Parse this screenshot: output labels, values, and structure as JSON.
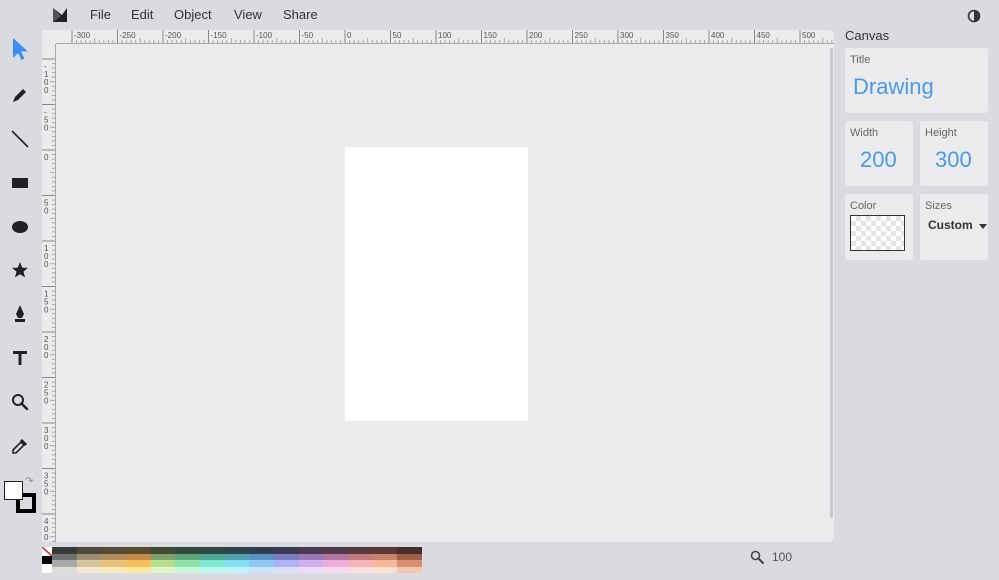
{
  "menubar": {
    "logo_icon": "method-draw-logo",
    "items": [
      "File",
      "Edit",
      "Object",
      "View",
      "Share"
    ],
    "theme_icon": "contrast-icon"
  },
  "toolbar": {
    "tools": [
      "select-tool",
      "pencil-tool",
      "line-tool",
      "rectangle-tool",
      "ellipse-tool",
      "star-tool",
      "pen-tool",
      "text-tool",
      "zoom-tool",
      "eyedropper-tool"
    ],
    "active": "select-tool",
    "fill_color": "#ffffff",
    "stroke_color": "#000000"
  },
  "rulers": {
    "x_ticks": [
      "-300",
      "-250",
      "-200",
      "-150",
      "-100",
      "-50",
      "0",
      "50",
      "100",
      "150",
      "200",
      "250",
      "300",
      "350",
      "400",
      "450",
      "500"
    ],
    "y_ticks": [
      "-100",
      "-50",
      "0",
      "50",
      "100",
      "150",
      "200",
      "250",
      "300",
      "350",
      "400"
    ]
  },
  "palette": {
    "rows": [
      [
        "#3a3a3a",
        "#504a3e",
        "#574b36",
        "#5c4a2e",
        "#3f4a33",
        "#324a3a",
        "#2d4a45",
        "#2d454d",
        "#2e3f52",
        "#3a3a54",
        "#4a3a52",
        "#523a4a",
        "#573a3e",
        "#5a3a34",
        "#4a2e2e"
      ],
      [
        "#707070",
        "#9b8d74",
        "#b08e5c",
        "#c28b47",
        "#7fa06a",
        "#5ea57a",
        "#4faa98",
        "#52a2b3",
        "#5c8fc2",
        "#7a7cc0",
        "#9a78b8",
        "#b177a0",
        "#c27a80",
        "#c8826a",
        "#a0604a"
      ],
      [
        "#a8a8a8",
        "#d4c49e",
        "#e8c27a",
        "#f5bf5c",
        "#b5df8e",
        "#8fe3aa",
        "#7fe8d2",
        "#84dff0",
        "#8fc8f5",
        "#aeb2f5",
        "#d1aef0",
        "#eaaed8",
        "#f5b2b8",
        "#f7b89a",
        "#d89070"
      ],
      [
        "#dcdcdc",
        "#f3e8cd",
        "#fde8b8",
        "#ffe6a0",
        "#e0f5c8",
        "#c8f5d8",
        "#bcf7ec",
        "#c0f2fb",
        "#c8e4fd",
        "#dcdffd",
        "#ecdafb",
        "#f8daee",
        "#fddde0",
        "#fde0d0",
        "#f2c8b0"
      ]
    ]
  },
  "zoom": {
    "icon": "zoom-icon",
    "value": "100"
  },
  "panel": {
    "title": "Canvas",
    "title_label": "Title",
    "title_value": "Drawing",
    "width_label": "Width",
    "width_value": "200",
    "height_label": "Height",
    "height_value": "300",
    "color_label": "Color",
    "sizes_label": "Sizes",
    "sizes_value": "Custom"
  },
  "colors": {
    "accent": "#4a9ae6",
    "select_tool": "#3d8df0"
  }
}
